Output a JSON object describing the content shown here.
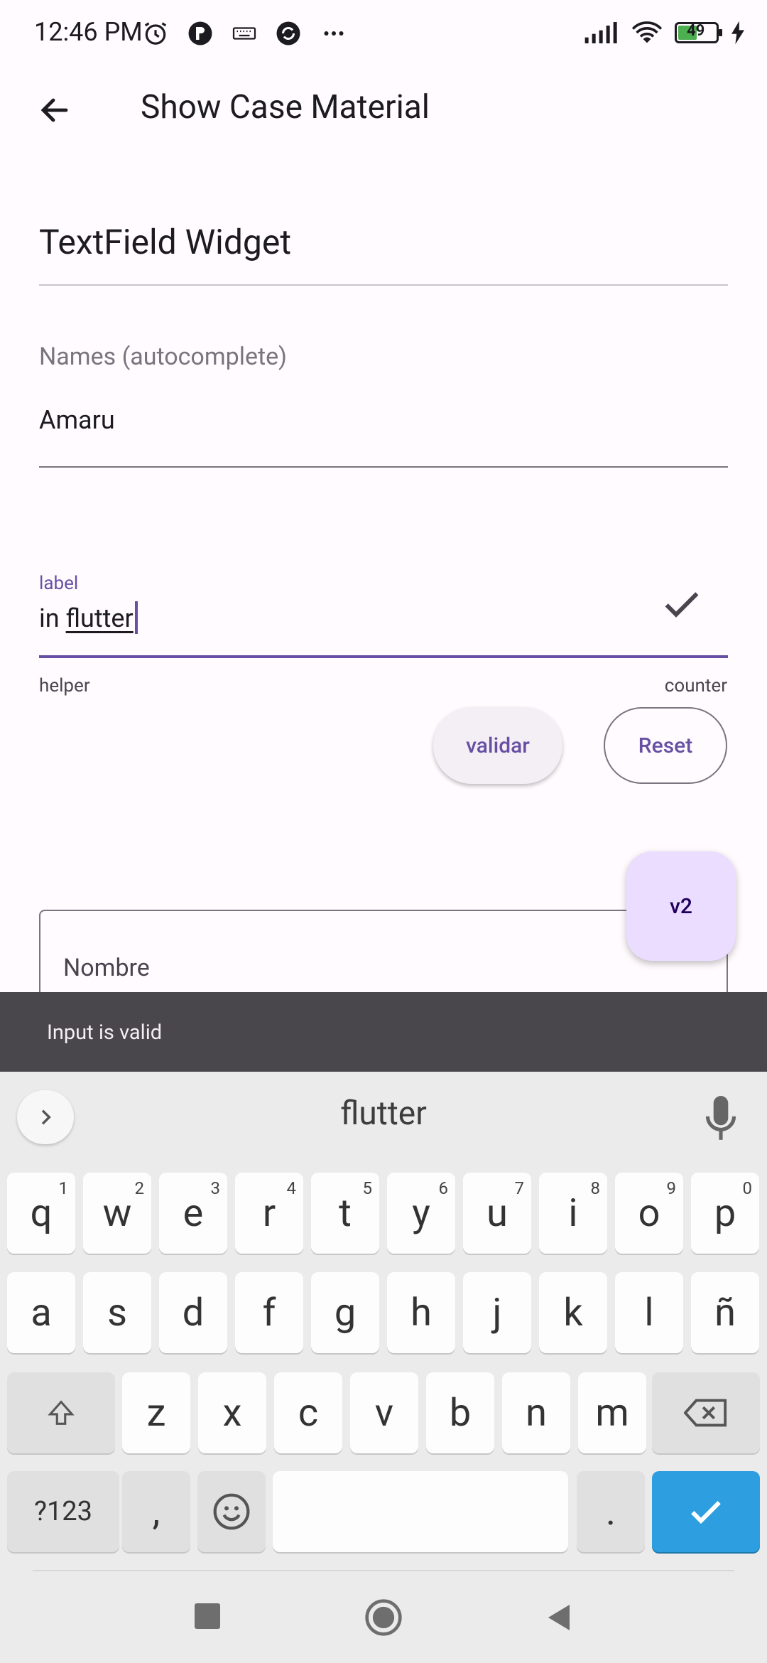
{
  "status_bar": {
    "time": "12:46 PM",
    "battery": "49",
    "icons_left": [
      "alarm-icon",
      "p-icon",
      "keyboard-icon",
      "sync-icon",
      "more-dots-icon"
    ],
    "icons_right": [
      "signal-icon",
      "wifi-icon",
      "battery-icon",
      "charging-icon"
    ]
  },
  "app_bar": {
    "title": "Show Case Material"
  },
  "content": {
    "section_title": "TextField Widget",
    "autocomplete": {
      "label": "Names (autocomplete)",
      "value": "Amaru"
    },
    "field": {
      "label": "label",
      "value_prefix": "in ",
      "value_underlined": "flutter",
      "helper": "helper",
      "counter": "counter"
    },
    "buttons": {
      "validate": "validar",
      "reset": "Reset"
    },
    "outlined_field": {
      "label": "Nombre"
    },
    "fab": {
      "label": "v2"
    }
  },
  "snackbar": {
    "message": "Input is valid"
  },
  "keyboard": {
    "suggestion": "flutter",
    "row1": [
      {
        "key": "q",
        "hint": "1"
      },
      {
        "key": "w",
        "hint": "2"
      },
      {
        "key": "e",
        "hint": "3"
      },
      {
        "key": "r",
        "hint": "4"
      },
      {
        "key": "t",
        "hint": "5"
      },
      {
        "key": "y",
        "hint": "6"
      },
      {
        "key": "u",
        "hint": "7"
      },
      {
        "key": "i",
        "hint": "8"
      },
      {
        "key": "o",
        "hint": "9"
      },
      {
        "key": "p",
        "hint": "0"
      }
    ],
    "row2": [
      "a",
      "s",
      "d",
      "f",
      "g",
      "h",
      "j",
      "k",
      "l",
      "ñ"
    ],
    "row3": [
      "z",
      "x",
      "c",
      "v",
      "b",
      "n",
      "m"
    ],
    "symbols_key": "?123",
    "comma_key": ",",
    "period_key": ".",
    "accent_color": "#2d9fe0"
  },
  "theme": {
    "primary": "#6750a4",
    "background": "#fffbfe",
    "fab_container": "#eaddff"
  }
}
